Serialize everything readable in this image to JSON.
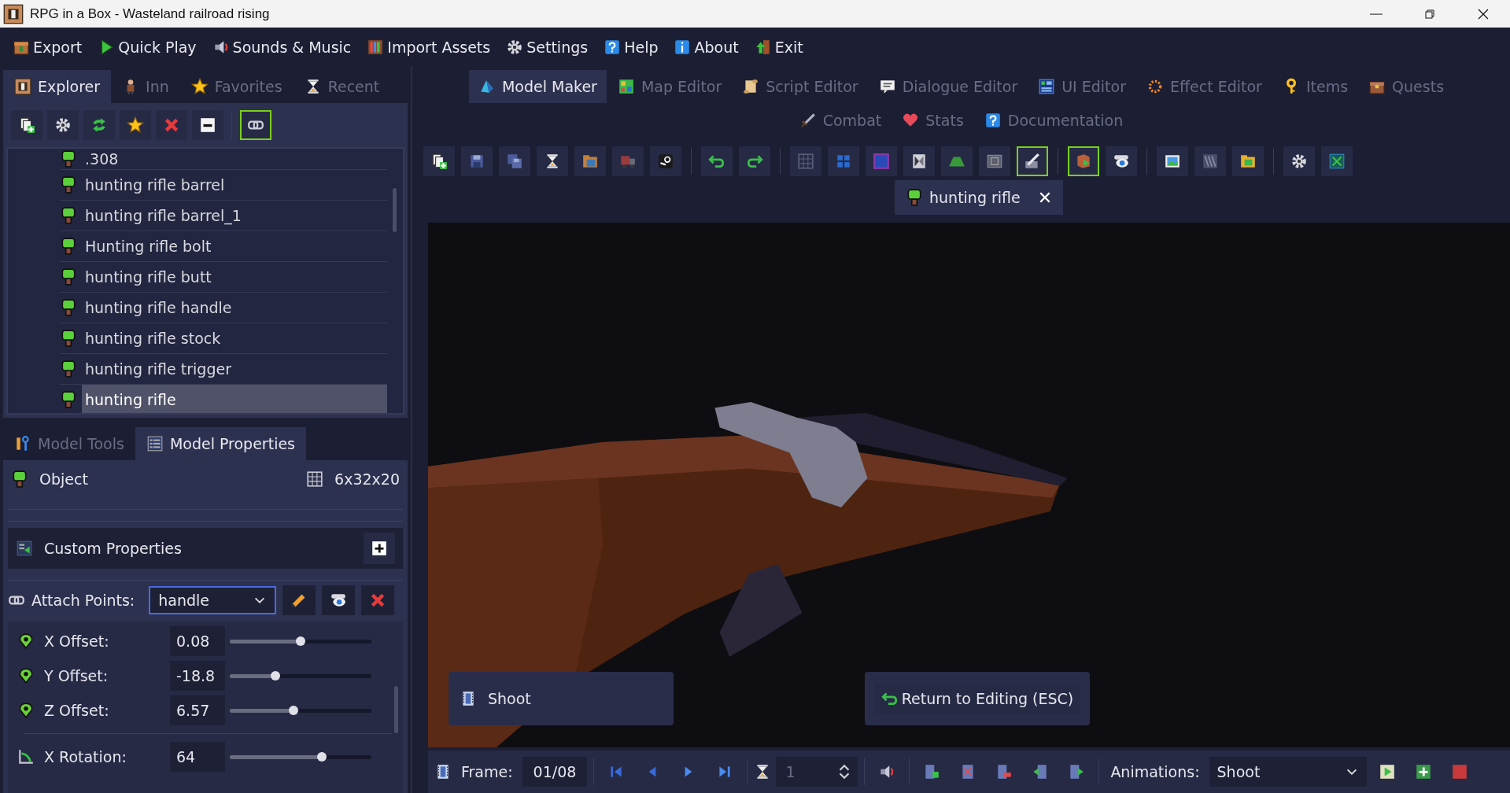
{
  "window": {
    "title": "RPG in a Box - Wasteland railroad rising"
  },
  "menu": [
    {
      "label": "Export"
    },
    {
      "label": "Quick Play"
    },
    {
      "label": "Sounds & Music"
    },
    {
      "label": "Import Assets"
    },
    {
      "label": "Settings"
    },
    {
      "label": "Help"
    },
    {
      "label": "About"
    },
    {
      "label": "Exit"
    }
  ],
  "left_tabs": [
    {
      "label": "Explorer",
      "selected": true
    },
    {
      "label": "Inn",
      "selected": false
    },
    {
      "label": "Favorites",
      "selected": false
    },
    {
      "label": "Recent",
      "selected": false
    }
  ],
  "explorer_toolbar": [
    {
      "highlighted": false
    },
    {
      "highlighted": false
    },
    {
      "highlighted": false
    },
    {
      "highlighted": false
    },
    {
      "highlighted": false
    },
    {
      "highlighted": false
    },
    {
      "highlighted": true
    }
  ],
  "tree": [
    {
      "label": ".308",
      "selected": false
    },
    {
      "label": "hunting rifle barrel",
      "selected": false
    },
    {
      "label": "hunting rifle barrel_1",
      "selected": false
    },
    {
      "label": "Hunting rifle bolt",
      "selected": false
    },
    {
      "label": "hunting rifle butt",
      "selected": false
    },
    {
      "label": "hunting rifle handle",
      "selected": false
    },
    {
      "label": "hunting rifle stock",
      "selected": false
    },
    {
      "label": "hunting rifle trigger",
      "selected": false
    },
    {
      "label": "hunting rifle",
      "selected": true
    }
  ],
  "bottom_tabs": [
    {
      "label": "Model Tools",
      "selected": false
    },
    {
      "label": "Model Properties",
      "selected": true
    }
  ],
  "object": {
    "label": "Object",
    "size": "6x32x20"
  },
  "custom_properties": {
    "label": "Custom Properties"
  },
  "attach_points": {
    "label": "Attach Points:",
    "value": "handle"
  },
  "properties": [
    {
      "kind": "offset",
      "label": "X Offset:",
      "value": "0.08",
      "level": 0.5
    },
    {
      "kind": "offset",
      "label": "Y Offset:",
      "value": "-18.8",
      "level": 0.32
    },
    {
      "kind": "offset",
      "label": "Z Offset:",
      "value": "6.57",
      "level": 0.45
    },
    {
      "kind": "rotation",
      "label": "X Rotation:",
      "value": "64",
      "level": 0.65
    }
  ],
  "editor_tabs": [
    {
      "label": "Model Maker",
      "selected": true
    },
    {
      "label": "Map Editor",
      "selected": false
    },
    {
      "label": "Script Editor",
      "selected": false
    },
    {
      "label": "Dialogue Editor",
      "selected": false
    },
    {
      "label": "UI Editor",
      "selected": false
    },
    {
      "label": "Effect Editor",
      "selected": false
    },
    {
      "label": "Items",
      "selected": false
    },
    {
      "label": "Quests",
      "selected": false
    }
  ],
  "editor_tabs_row2": [
    {
      "label": "Combat",
      "selected": false
    },
    {
      "label": "Stats",
      "selected": false
    },
    {
      "label": "Documentation",
      "selected": false
    }
  ],
  "toolbar": [
    {
      "highlighted": false
    },
    {
      "highlighted": false
    },
    {
      "highlighted": false
    },
    {
      "highlighted": false
    },
    {
      "highlighted": false
    },
    {
      "highlighted": false
    },
    {
      "highlighted": false
    },
    {
      "highlighted": false
    },
    {
      "highlighted": false
    },
    {
      "highlighted": false
    },
    {
      "highlighted": false
    },
    {
      "highlighted": false
    },
    {
      "highlighted": false
    },
    {
      "highlighted": false
    },
    {
      "highlighted": false
    },
    {
      "highlighted": true
    },
    {
      "highlighted": true
    },
    {
      "highlighted": false
    },
    {
      "highlighted": false
    },
    {
      "highlighted": false
    },
    {
      "highlighted": false
    },
    {
      "highlighted": false
    },
    {
      "highlighted": false
    }
  ],
  "document_tab": {
    "label": "hunting rifle",
    "close": "✕"
  },
  "viewport": {
    "animation_label": "Shoot",
    "return_button": "Return to Editing (ESC)"
  },
  "animation_bar": {
    "frame_label": "Frame:",
    "frame": "01/08",
    "speed": "1",
    "animations_label": "Animations:",
    "animation": "Shoot"
  }
}
